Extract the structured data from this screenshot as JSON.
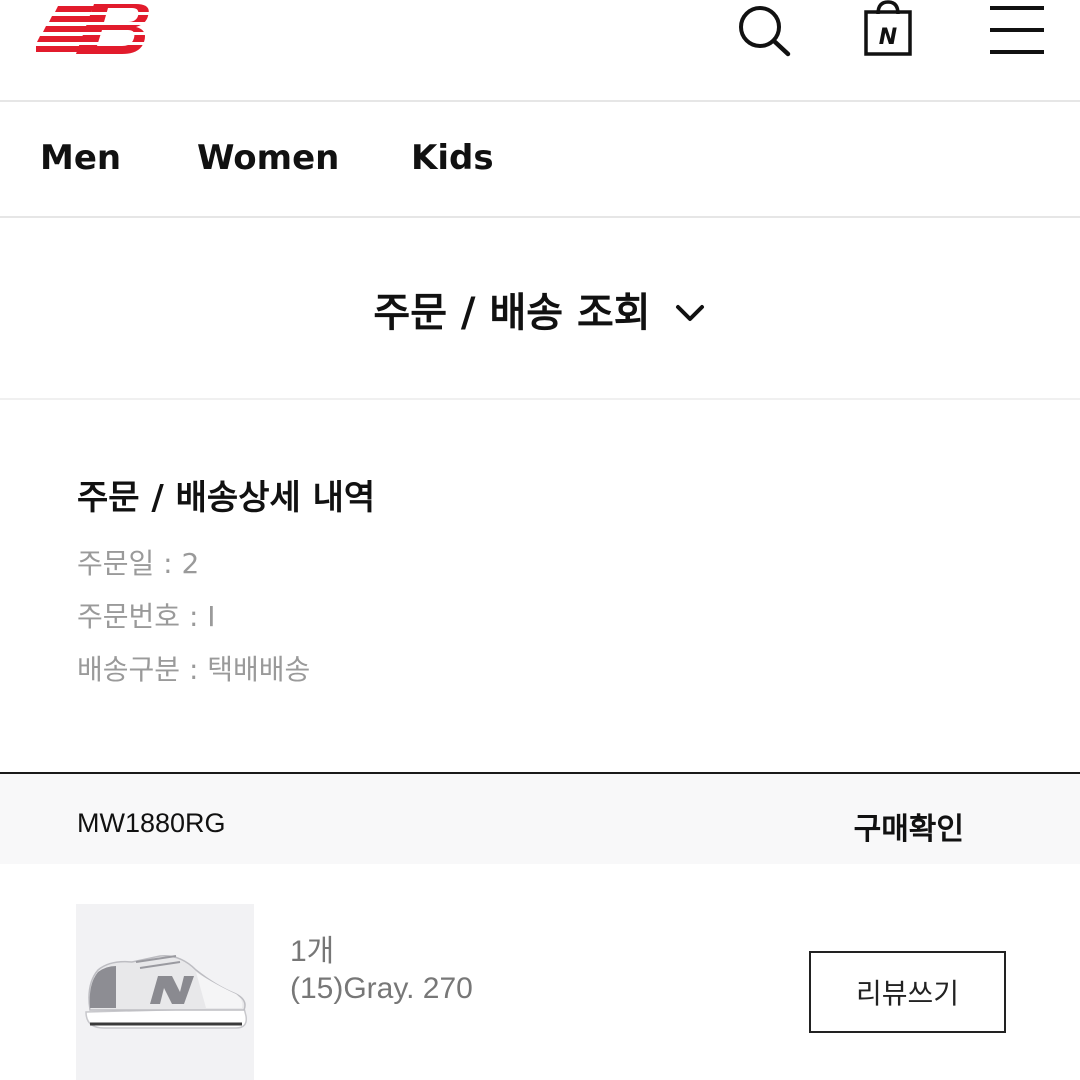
{
  "header": {
    "logo_icon": "new-balance-logo",
    "search_icon": "search-icon",
    "bag_icon": "shopping-bag-icon",
    "bag_letter": "N",
    "menu_icon": "hamburger-menu-icon",
    "brand_color": "#e21b2c"
  },
  "nav": {
    "items": [
      {
        "label": "Men"
      },
      {
        "label": "Women"
      },
      {
        "label": "Kids"
      }
    ]
  },
  "page": {
    "title": "주문 / 배송 조회",
    "dropdown_icon": "chevron-down-icon"
  },
  "detail": {
    "title": "주문 / 배송상세 내역",
    "order_date": "주문일 : 2",
    "order_number": "주문번호 : I",
    "delivery_type": "배송구분 : 택배배송"
  },
  "order": {
    "model_code": "MW1880RG",
    "status": "구매확인",
    "item": {
      "quantity": "1개",
      "option": "(15)Gray. 270",
      "review_button": "리뷰쓰기",
      "thumbnail": "gray-sneaker-image"
    }
  }
}
